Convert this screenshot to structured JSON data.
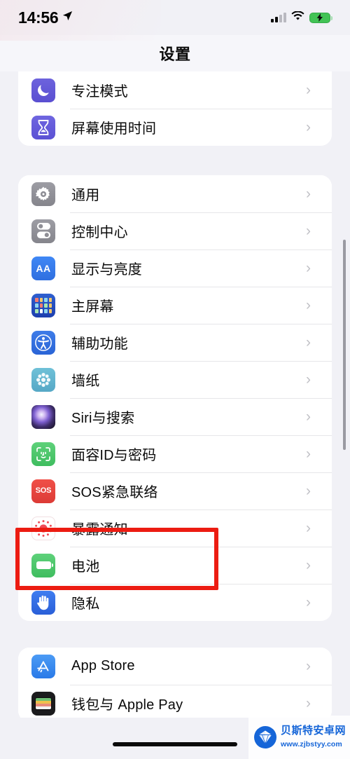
{
  "status_bar": {
    "time": "14:56",
    "location_icon": "location-arrow-icon",
    "cellular_icon": "cellular-signal-icon",
    "wifi_icon": "wifi-icon",
    "battery_icon": "battery-charging-icon"
  },
  "nav": {
    "title": "设置"
  },
  "groups": [
    {
      "id": "group-top",
      "rows": [
        {
          "label": "专注模式",
          "icon": "focus-mode-icon",
          "icon_class": "ic-focus",
          "clipped": true
        },
        {
          "label": "屏幕使用时间",
          "icon": "screen-time-icon",
          "icon_class": "ic-screentime"
        }
      ]
    },
    {
      "id": "group-system",
      "rows": [
        {
          "label": "通用",
          "icon": "general-gear-icon",
          "icon_class": "ic-general"
        },
        {
          "label": "控制中心",
          "icon": "control-center-icon",
          "icon_class": "ic-control"
        },
        {
          "label": "显示与亮度",
          "icon": "display-brightness-icon",
          "icon_class": "ic-display"
        },
        {
          "label": "主屏幕",
          "icon": "home-screen-icon",
          "icon_class": "ic-home"
        },
        {
          "label": "辅助功能",
          "icon": "accessibility-icon",
          "icon_class": "ic-access"
        },
        {
          "label": "墙纸",
          "icon": "wallpaper-icon",
          "icon_class": "ic-wall"
        },
        {
          "label": "Siri与搜索",
          "icon": "siri-icon",
          "icon_class": "ic-siri"
        },
        {
          "label": "面容ID与密码",
          "icon": "face-id-icon",
          "icon_class": "ic-faceid"
        },
        {
          "label": "SOS紧急联络",
          "icon": "emergency-sos-icon",
          "icon_class": "ic-sos"
        },
        {
          "label": "暴露通知",
          "icon": "exposure-notification-icon",
          "icon_class": "ic-exposure"
        },
        {
          "label": "电池",
          "icon": "battery-icon",
          "icon_class": "ic-battery",
          "highlighted": true
        },
        {
          "label": "隐私",
          "icon": "privacy-hand-icon",
          "icon_class": "ic-privacy"
        }
      ]
    },
    {
      "id": "group-store",
      "rows": [
        {
          "label": "App Store",
          "icon": "app-store-icon",
          "icon_class": "ic-appstore"
        },
        {
          "label": "钱包与 Apple Pay",
          "icon": "wallet-apple-pay-icon",
          "icon_class": "ic-wallet"
        }
      ]
    }
  ],
  "chevron": "›",
  "highlight": {
    "color": "#ec1c12",
    "target_label": "电池"
  },
  "watermark": {
    "title": "贝斯特安卓网",
    "url": "www.zjbstyy.com",
    "logo_icon": "shell-logo-icon"
  },
  "colors": {
    "page_background": "#f1f1f6",
    "card_background": "#ffffff",
    "separator": "#e6e6e9",
    "chevron": "#c2c2c7",
    "highlight_red": "#ec1c12",
    "watermark_blue": "#1565d8"
  }
}
